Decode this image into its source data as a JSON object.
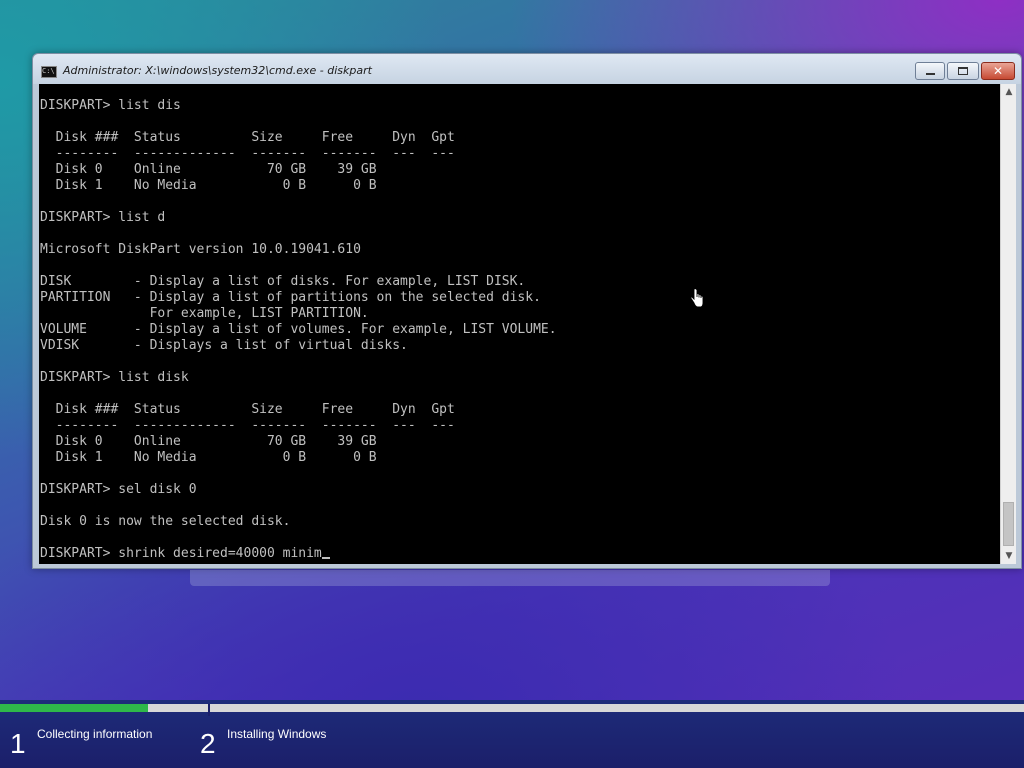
{
  "window": {
    "title": "Administrator: X:\\windows\\system32\\cmd.exe - diskpart",
    "icon": "cmd-icon",
    "controls": {
      "minimize": "",
      "maximize": "",
      "close": "✕"
    }
  },
  "console": {
    "text": "DISKPART> list dis\n\n  Disk ###  Status         Size     Free     Dyn  Gpt\n  --------  -------------  -------  -------  ---  ---\n  Disk 0    Online           70 GB    39 GB\n  Disk 1    No Media           0 B      0 B\n\nDISKPART> list d\n\nMicrosoft DiskPart version 10.0.19041.610\n\nDISK        - Display a list of disks. For example, LIST DISK.\nPARTITION   - Display a list of partitions on the selected disk.\n              For example, LIST PARTITION.\nVOLUME      - Display a list of volumes. For example, LIST VOLUME.\nVDISK       - Displays a list of virtual disks.\n\nDISKPART> list disk\n\n  Disk ###  Status         Size     Free     Dyn  Gpt\n  --------  -------------  -------  -------  ---  ---\n  Disk 0    Online           70 GB    39 GB\n  Disk 1    No Media           0 B      0 B\n\nDISKPART> sel disk 0\n\nDisk 0 is now the selected disk.\n\n",
    "current_input": "DISKPART> shrink desired=40000 minim"
  },
  "scrollbar": {
    "up_arrow": "▲",
    "down_arrow": "▼"
  },
  "setup": {
    "progress_fraction": 0.145,
    "steps": [
      {
        "number": "1",
        "label": "Collecting information"
      },
      {
        "number": "2",
        "label": "Installing Windows"
      }
    ]
  },
  "colors": {
    "console_bg": "#000000",
    "console_text": "#c0c0c0",
    "progress_fill": "#2fb84a",
    "setup_bar": "#1b1f6a"
  }
}
